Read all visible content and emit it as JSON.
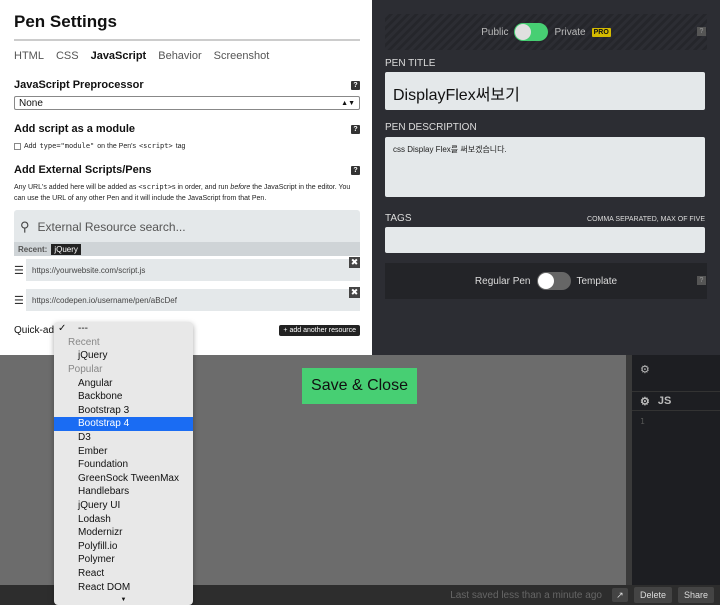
{
  "settings": {
    "title": "Pen Settings",
    "tabs": [
      "HTML",
      "CSS",
      "JavaScript",
      "Behavior",
      "Screenshot"
    ],
    "active_tab": "JavaScript",
    "preprocessor": {
      "heading": "JavaScript Preprocessor",
      "value": "None"
    },
    "module": {
      "heading": "Add script as a module",
      "prefix": "Add",
      "code": "type=\"module\"",
      "middle": "on the Pen's",
      "tag_code": "<script>",
      "suffix": "tag"
    },
    "external": {
      "heading": "Add External Scripts/Pens",
      "desc_1": "Any URL's added here will be added as",
      "desc_code": "<script>",
      "desc_2": "s in order, and run",
      "desc_em": "before",
      "desc_3": "the JavaScript in the editor. You can use the URL of any other Pen and it will include the JavaScript from that Pen.",
      "search_placeholder": "External Resource search...",
      "recent_label": "Recent:",
      "recent_tag": "jQuery",
      "resource_1": "https://yourwebsite.com/script.js",
      "resource_2": "https://codepen.io/username/pen/aBcDef",
      "quick_add_label": "Quick-add:",
      "add_button": "+ add another resource"
    },
    "help_glyph": "?",
    "remove_glyph": "✖",
    "handle_glyph": "☰"
  },
  "right": {
    "public_label": "Public",
    "private_label": "Private",
    "pro_badge": "PRO",
    "pen_title_label": "PEN TITLE",
    "pen_title_value": "DisplayFlex써보기",
    "pen_desc_label": "PEN DESCRIPTION",
    "pen_desc_value": "css Display Flex를 써보겠습니다.",
    "tags_label": "TAGS",
    "tags_hint": "COMMA SEPARATED, MAX OF FIVE",
    "regular_label": "Regular Pen",
    "template_label": "Template"
  },
  "save_button": "Save & Close",
  "editor": {
    "js_label": "JS"
  },
  "footer": {
    "saved_text": "Last saved less than a minute ago",
    "delete_label": "Delete",
    "share_label": "Share"
  },
  "dropdown": {
    "checked": "---",
    "recent_group": "Recent",
    "recent_items": [
      "jQuery"
    ],
    "popular_group": "Popular",
    "popular_items": [
      "Angular",
      "Backbone",
      "Bootstrap 3",
      "Bootstrap 4",
      "D3",
      "Ember",
      "Foundation",
      "GreenSock TweenMax",
      "Handlebars",
      "jQuery UI",
      "Lodash",
      "Modernizr",
      "Polyfill.io",
      "Polymer",
      "React",
      "React DOM"
    ],
    "selected": "Bootstrap 4"
  },
  "colors": {
    "accent_green": "#47cf73",
    "selection_blue": "#1a6cf3",
    "pro_yellow": "#d5bb00",
    "dark_panel": "#2c2d33"
  }
}
